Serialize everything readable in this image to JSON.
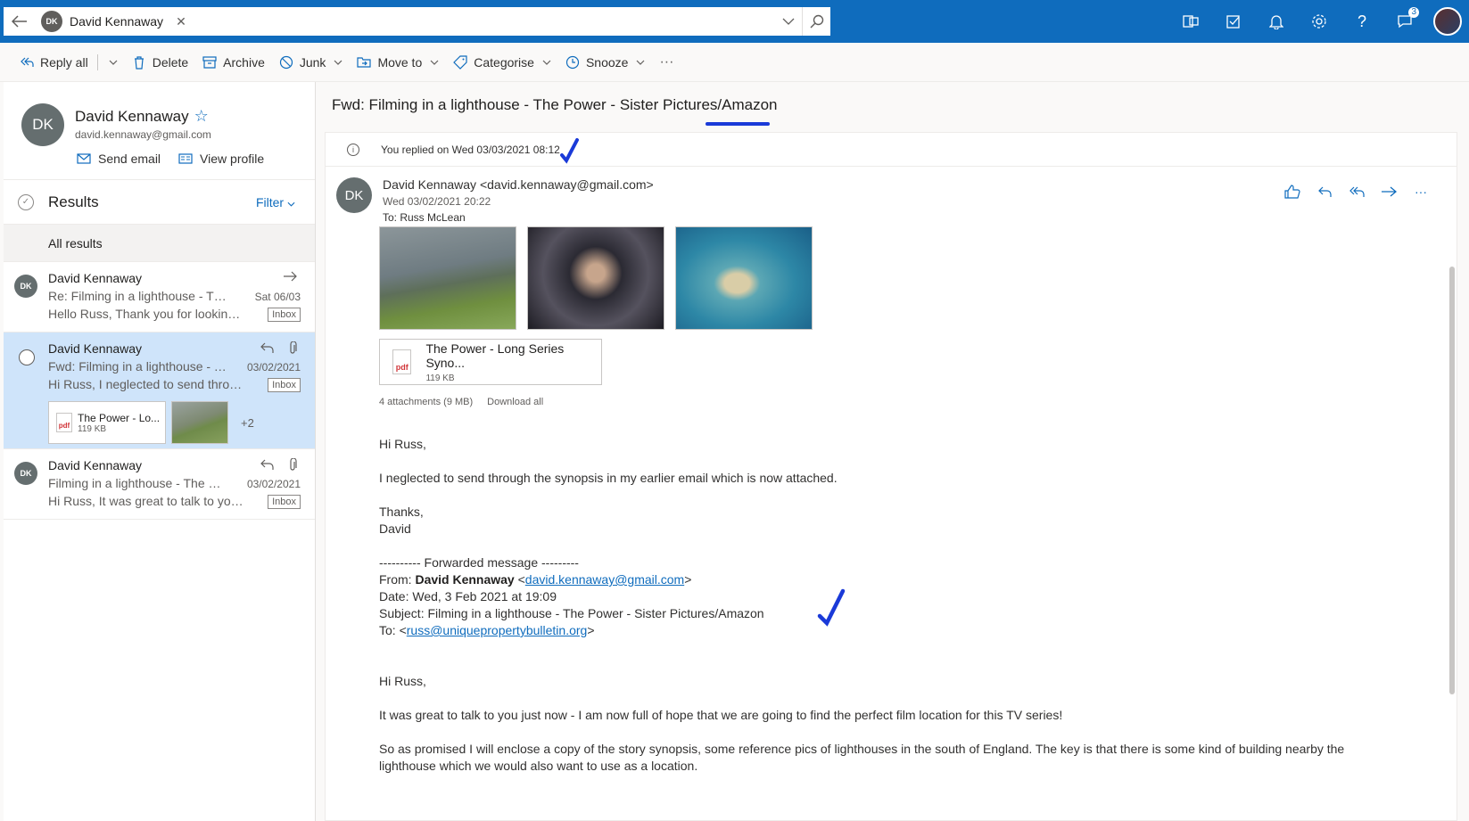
{
  "topbar": {
    "search_chip_initials": "DK",
    "search_chip_name": "David Kennaway",
    "notification_badge": "3"
  },
  "commands": {
    "reply_all": "Reply all",
    "delete": "Delete",
    "archive": "Archive",
    "junk": "Junk",
    "move_to": "Move to",
    "categorise": "Categorise",
    "snooze": "Snooze",
    "more": "···"
  },
  "contact": {
    "initials": "DK",
    "name": "David Kennaway",
    "email": "david.kennaway@gmail.com",
    "send_email": "Send email",
    "view_profile": "View profile"
  },
  "results": {
    "title": "Results",
    "filter": "Filter",
    "all_results": "All results"
  },
  "mail_list": [
    {
      "initials": "DK",
      "from": "David Kennaway",
      "subject": "Re: Filming in a lighthouse - The Power",
      "preview": "Hello Russ, Thank you for looking into this",
      "date": "Sat 06/03",
      "tag": "Inbox"
    },
    {
      "from": "David Kennaway",
      "subject": "Fwd: Filming in a lighthouse - The Power",
      "preview": "Hi Russ, I neglected to send through the synopsis",
      "date": "03/02/2021",
      "tag": "Inbox",
      "attachment_name": "The Power - Lo...",
      "attachment_size": "119 KB",
      "more_count": "+2"
    },
    {
      "initials": "DK",
      "from": "David Kennaway",
      "subject": "Filming in a lighthouse - The Power",
      "preview": "Hi Russ, It was great to talk to you just now",
      "date": "03/02/2021",
      "tag": "Inbox"
    }
  ],
  "reading": {
    "subject": "Fwd: Filming in a lighthouse - The Power - Sister Pictures/Amazon",
    "replied_info": "You replied on Wed 03/03/2021 08:12",
    "sender_initials": "DK",
    "sender": "David Kennaway <david.kennaway@gmail.com>",
    "sent_date": "Wed 03/02/2021 20:22",
    "to": "To:  Russ McLean",
    "attachment_name": "The Power - Long Series Syno...",
    "attachment_size": "119 KB",
    "attachments_summary": "4 attachments (9 MB)",
    "download_all": "Download all",
    "pdf_label": "pdf"
  },
  "body": {
    "greeting": "Hi Russ,",
    "line1": "I neglected to send through the synopsis in my earlier email which is now attached.",
    "thanks": "Thanks,",
    "signoff": "David",
    "fwd_header": "---------- Forwarded message ---------",
    "from_label": "From: ",
    "from_name": "David Kennaway",
    "from_email": "david.kennaway@gmail.com",
    "date_line": "Date: Wed, 3 Feb 2021 at 19:09",
    "subject_line": "Subject: Filming in a lighthouse - The Power - Sister Pictures/Amazon",
    "to_label": "To: ",
    "to_email": "russ@uniquepropertybulletin.org",
    "greeting2": "Hi Russ,",
    "para1": "It was great to talk to you just now - I am now full of hope that we are going to find the perfect film location for this TV series!",
    "para2": "So as promised I will enclose a copy of the story synopsis, some reference pics of lighthouses in the south of England. The key is that there is some kind of building nearby the lighthouse which we would also want to use as a location."
  },
  "colors": {
    "brand_blue": "#0f6cbd",
    "selected_bg": "#cfe4fa",
    "annotation_blue": "#1a3ad8"
  }
}
